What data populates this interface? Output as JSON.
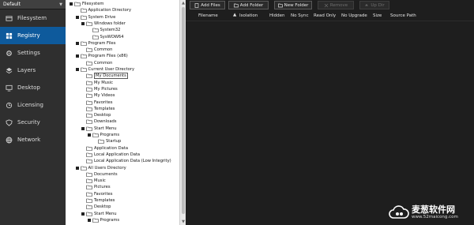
{
  "profile": {
    "name": "Default"
  },
  "sidebar": {
    "items": [
      {
        "label": "Filesystem",
        "icon": "filesystem-icon",
        "active": false
      },
      {
        "label": "Registry",
        "icon": "registry-icon",
        "active": true
      },
      {
        "label": "Settings",
        "icon": "gear-icon",
        "active": false
      },
      {
        "label": "Layers",
        "icon": "layers-icon",
        "active": false
      },
      {
        "label": "Desktop",
        "icon": "desktop-icon",
        "active": false
      },
      {
        "label": "Licensing",
        "icon": "licensing-icon",
        "active": false
      },
      {
        "label": "Security",
        "icon": "shield-icon",
        "active": false
      },
      {
        "label": "Network",
        "icon": "network-icon",
        "active": false
      }
    ]
  },
  "tree": {
    "nodes": [
      {
        "label": "Filesystem",
        "depth": 0,
        "expander": true
      },
      {
        "label": "Application Directory",
        "depth": 1,
        "expander": false
      },
      {
        "label": "System Drive",
        "depth": 1,
        "expander": true
      },
      {
        "label": "Windows folder",
        "depth": 2,
        "expander": true
      },
      {
        "label": "System32",
        "depth": 3,
        "expander": false
      },
      {
        "label": "SysWOW64",
        "depth": 3,
        "expander": false
      },
      {
        "label": "Program Files",
        "depth": 1,
        "expander": true
      },
      {
        "label": "Common",
        "depth": 2,
        "expander": false
      },
      {
        "label": "Program Files (x86)",
        "depth": 1,
        "expander": true
      },
      {
        "label": "Common",
        "depth": 2,
        "expander": false
      },
      {
        "label": "Current User Directory",
        "depth": 1,
        "expander": true
      },
      {
        "label": "My Documents",
        "depth": 2,
        "expander": false,
        "selected": true
      },
      {
        "label": "My Music",
        "depth": 2,
        "expander": false
      },
      {
        "label": "My Pictures",
        "depth": 2,
        "expander": false
      },
      {
        "label": "My Videos",
        "depth": 2,
        "expander": false
      },
      {
        "label": "Favorites",
        "depth": 2,
        "expander": false
      },
      {
        "label": "Templates",
        "depth": 2,
        "expander": false
      },
      {
        "label": "Desktop",
        "depth": 2,
        "expander": false
      },
      {
        "label": "Downloads",
        "depth": 2,
        "expander": false
      },
      {
        "label": "Start Menu",
        "depth": 2,
        "expander": true
      },
      {
        "label": "Programs",
        "depth": 3,
        "expander": true
      },
      {
        "label": "Startup",
        "depth": 4,
        "expander": false
      },
      {
        "label": "Application Data",
        "depth": 2,
        "expander": false
      },
      {
        "label": "Local Application Data",
        "depth": 2,
        "expander": false
      },
      {
        "label": "Local Application Data (Low Integrity)",
        "depth": 2,
        "expander": false
      },
      {
        "label": "All Users Directory",
        "depth": 1,
        "expander": true
      },
      {
        "label": "Documents",
        "depth": 2,
        "expander": false
      },
      {
        "label": "Music",
        "depth": 2,
        "expander": false
      },
      {
        "label": "Pictures",
        "depth": 2,
        "expander": false
      },
      {
        "label": "Favorites",
        "depth": 2,
        "expander": false
      },
      {
        "label": "Templates",
        "depth": 2,
        "expander": false
      },
      {
        "label": "Desktop",
        "depth": 2,
        "expander": false
      },
      {
        "label": "Start Menu",
        "depth": 2,
        "expander": true
      },
      {
        "label": "Programs",
        "depth": 3,
        "expander": true
      }
    ]
  },
  "toolbar": {
    "buttons": [
      {
        "label": "Add Files",
        "icon": "add-files-icon",
        "enabled": true
      },
      {
        "label": "Add Folder",
        "icon": "add-folder-icon",
        "enabled": true
      },
      {
        "label": "New Folder",
        "icon": "new-folder-icon",
        "enabled": true
      },
      {
        "label": "Remove",
        "icon": "remove-icon",
        "enabled": false
      },
      {
        "label": "Up Dir",
        "icon": "up-dir-icon",
        "enabled": false
      }
    ]
  },
  "columns": [
    "Filename",
    "Isolation",
    "Hidden",
    "No Sync",
    "Read Only",
    "No Upgrade",
    "Size",
    "Source Path"
  ],
  "watermark": {
    "title": "麦葱软件网",
    "url": "www.52maicong.com"
  },
  "colors": {
    "accent": "#0e5a9c",
    "sidebar": "#2f2f2f",
    "main": "#1e1e1e",
    "tree": "#ffffff"
  }
}
